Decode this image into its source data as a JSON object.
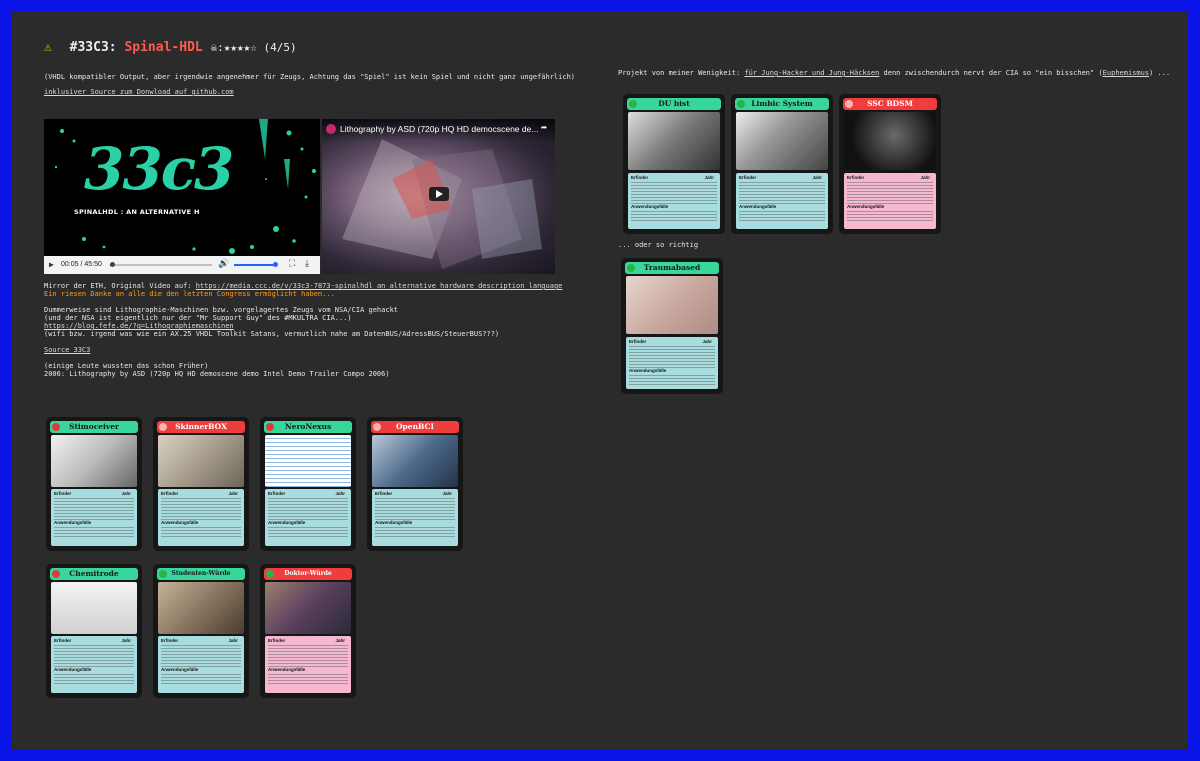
{
  "page": {
    "warning_icon": "warning-triangle-icon",
    "title_prefix": "#33C3:",
    "title_name": "Spinal-HDL",
    "title_rating": "☠:★★★★☆ (4/5)"
  },
  "left": {
    "intro": "(VHDL kompatibler Output, aber irgendwie angenehmer für Zeugs, Achtung das \"Spiel\" ist kein Spiel und nicht ganz ungefährlich)",
    "source_link": "inklusiver Source zum Donwload auf github.com",
    "video": {
      "logo_text": "33c3",
      "subtitle": "SPINALHDL : AN ALTERNATIVE H",
      "time": "00:05 / 45:50"
    },
    "youtube": {
      "title": "Lithography by ASD (720p HQ HD democscene de..."
    },
    "mirror_prefix": "Mirror der ETH, Original Video auf:",
    "mirror_link": "https://media.ccc.de/v/33c3-7873-spinalhdl_an_alternative_hardware_description_language",
    "thanks": "Ein riesen Danke an alle die den letzten Congress ermöglicht haben...",
    "dummer_1": "Dummerweise sind Lithographie-Maschinen bzw. vorgelagertes Zeugs vom NSA/CIA gehackt",
    "dummer_2": "(und der NSA ist eigentlich nur der \"Mr Support Guy\" des #MKULTRA CIA...)",
    "fefe_link": "https://blog.fefe.de/?q=Lithographiemaschinen",
    "wifi": "(wifi bzw. irgend was wie ein AX.25 VHDL Toolkit Satans, vermutlich nahe am DatenBUS/AdressBUS/SteuerBUS???)",
    "source_33c3": "Source 33C3",
    "einige": "(einige Leute wussten das schon Früher)",
    "lithography": "2006: Lithography by ASD (720p HQ HD demoscene demo Intel Demo Trailer Compo 2006)"
  },
  "right": {
    "projekt_prefix": "Projekt von meiner Wenigkeit:",
    "projekt_link": "für Jung-Hacker und Jung-Häcksen",
    "projekt_mid": "denn zwischendurch nervt der CIA so \"ein bisschen\" (",
    "euphemismus": "Euphemismus",
    "projekt_end": ") ...",
    "oder": "... oder so richtig"
  },
  "card_labels": {
    "erfinder": "Erfinder",
    "jahr": "Jahr",
    "anwendung": "Anwendungsfälle"
  },
  "cards_top": [
    {
      "title": "DU bist SCHIZOPHREN"
    },
    {
      "title": "Limbic System Vulnerability"
    },
    {
      "title": "SSC BDSM"
    }
  ],
  "card_trauma": {
    "title": "Traumabased MindControl"
  },
  "cards_row1": [
    {
      "title": "Stimoceiver"
    },
    {
      "title": "SkinnerBOX"
    },
    {
      "title": "NeroNexus Implantate"
    },
    {
      "title": "OpenBCI"
    }
  ],
  "cards_row2": [
    {
      "title": "Chemitrode"
    },
    {
      "title": "Studenten-Würde (Sündenbock)"
    },
    {
      "title": "Doktor-Würde (sarkasmus)"
    }
  ],
  "colors": {
    "border": "#0a14e6",
    "background": "#2b2b2b",
    "accent_red": "#ff5a4d",
    "orange": "#ff9c1a",
    "card_cyan": "#a8dde0",
    "card_pink": "#f5b8d0",
    "header_green": "#37d69a",
    "header_red": "#ef3d3d"
  }
}
